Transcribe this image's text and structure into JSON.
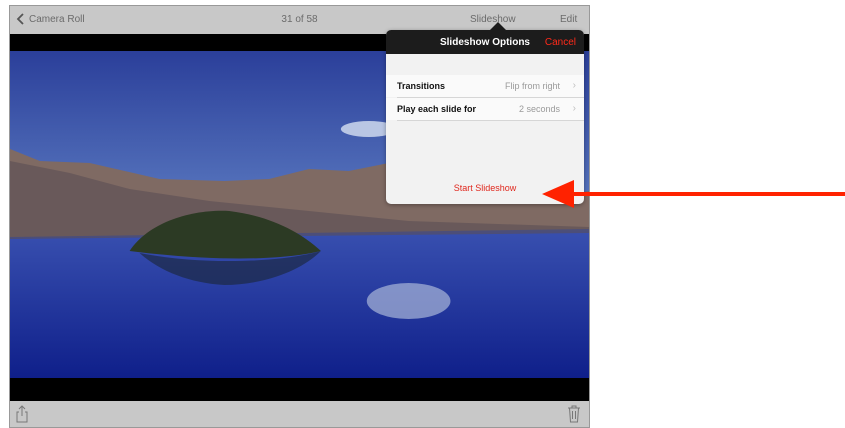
{
  "topbar": {
    "back_label": "Camera Roll",
    "counter": "31 of 58",
    "slideshow_label": "Slideshow",
    "edit_label": "Edit"
  },
  "popover": {
    "title": "Slideshow Options",
    "cancel_label": "Cancel",
    "rows": [
      {
        "label": "Transitions",
        "value": "Flip from right"
      },
      {
        "label": "Play each slide for",
        "value": "2 seconds"
      }
    ],
    "start_label": "Start Slideshow"
  },
  "colors": {
    "accent_red": "#e0281e",
    "arrow_red": "#ff2200",
    "bar_gray": "#c8c8c8"
  },
  "icons": {
    "back": "chevron-left-icon",
    "share": "share-icon",
    "trash": "trash-icon"
  }
}
